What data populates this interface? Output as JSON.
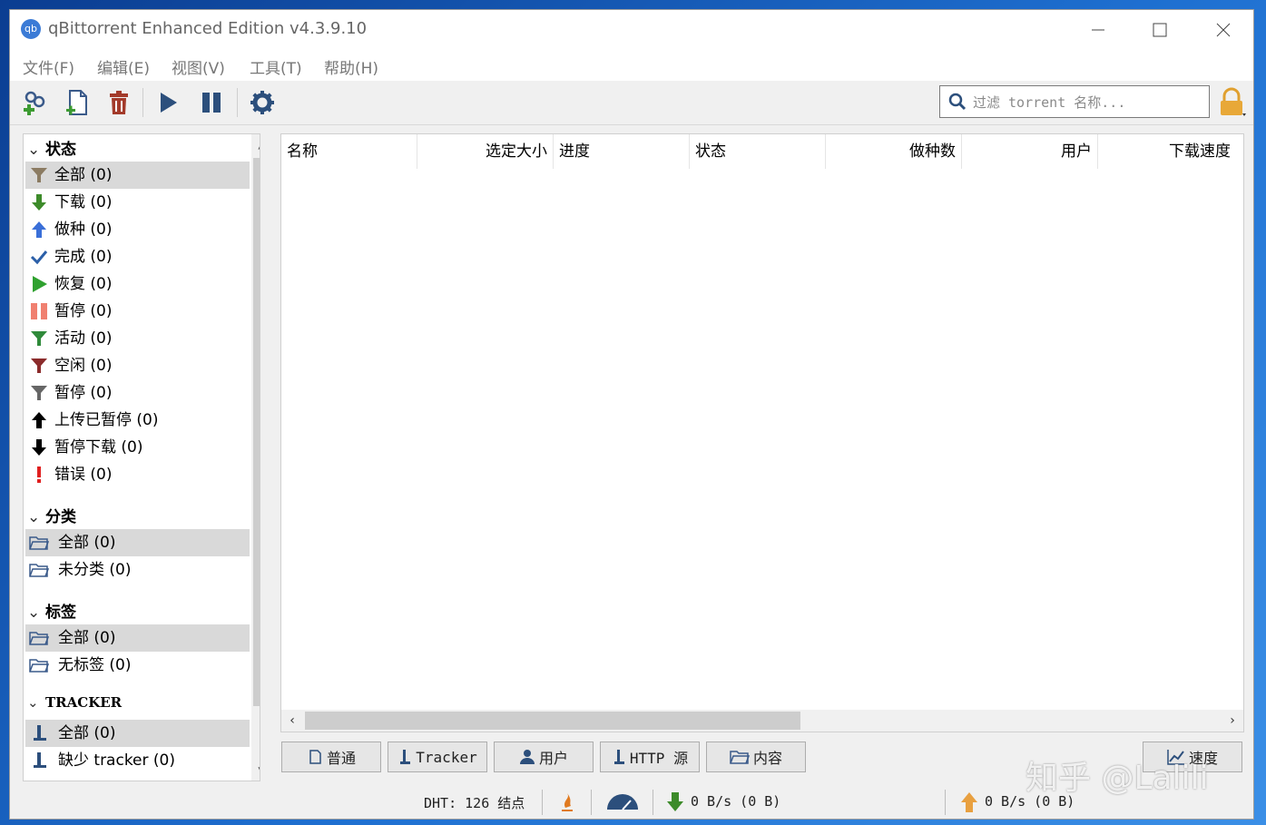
{
  "window": {
    "title": "qBittorrent Enhanced Edition v4.3.9.10",
    "app_icon_text": "qb"
  },
  "menu": [
    "文件(F)",
    "编辑(E)",
    "视图(V)",
    "工具(T)",
    "帮助(H)"
  ],
  "toolbar": {
    "buttons": [
      "add-torrent-link",
      "add-torrent-file",
      "delete",
      "resume",
      "pause",
      "options"
    ],
    "search_placeholder": "过滤 torrent 名称..."
  },
  "sidebar": {
    "status_header": "状态",
    "status_items": [
      {
        "label": "全部 (0)",
        "icon": "filter-icon",
        "color": "#8b7b62"
      },
      {
        "label": "下载 (0)",
        "icon": "download-arrow-icon",
        "color": "#3d8b2a"
      },
      {
        "label": "做种 (0)",
        "icon": "upload-arrow-icon",
        "color": "#3a6fd8"
      },
      {
        "label": "完成 (0)",
        "icon": "checkmark-icon",
        "color": "#2b5fa8"
      },
      {
        "label": "恢复 (0)",
        "icon": "play-icon",
        "color": "#2fa12f"
      },
      {
        "label": "暂停 (0)",
        "icon": "pause-icon",
        "color": "#f08070"
      },
      {
        "label": "活动 (0)",
        "icon": "filter-icon",
        "color": "#2f8a3a"
      },
      {
        "label": "空闲 (0)",
        "icon": "filter-icon",
        "color": "#8b2b2b"
      },
      {
        "label": "暂停 (0)",
        "icon": "filter-icon",
        "color": "#666666"
      },
      {
        "label": "上传已暂停 (0)",
        "icon": "upload-arrow-icon",
        "color": "#000000"
      },
      {
        "label": "暂停下载 (0)",
        "icon": "download-arrow-icon",
        "color": "#000000"
      },
      {
        "label": "错误 (0)",
        "icon": "exclamation-icon",
        "color": "#e02020"
      }
    ],
    "category_header": "分类",
    "category_items": [
      {
        "label": "全部 (0)",
        "icon": "folder-icon"
      },
      {
        "label": "未分类 (0)",
        "icon": "folder-icon"
      }
    ],
    "tags_header": "标签",
    "tag_items": [
      {
        "label": "全部 (0)",
        "icon": "folder-icon"
      },
      {
        "label": "无标签 (0)",
        "icon": "folder-icon"
      }
    ],
    "tracker_header": "TRACKER",
    "tracker_items": [
      {
        "label": "全部 (0)",
        "icon": "tracker-icon"
      },
      {
        "label": "缺少 tracker (0)",
        "icon": "tracker-icon"
      }
    ]
  },
  "table": {
    "columns": [
      "名称",
      "选定大小",
      "进度",
      "状态",
      "做种数",
      "用户",
      "下载速度"
    ],
    "rows": []
  },
  "bottom_tabs": [
    "普通",
    "Tracker",
    "用户",
    "HTTP 源",
    "内容"
  ],
  "speed_button": "速度",
  "status": {
    "dht": "DHT: 126 结点",
    "download": "0 B/s (0 B)",
    "upload": "0 B/s (0 B)"
  },
  "watermark": "知乎 @Lalili"
}
